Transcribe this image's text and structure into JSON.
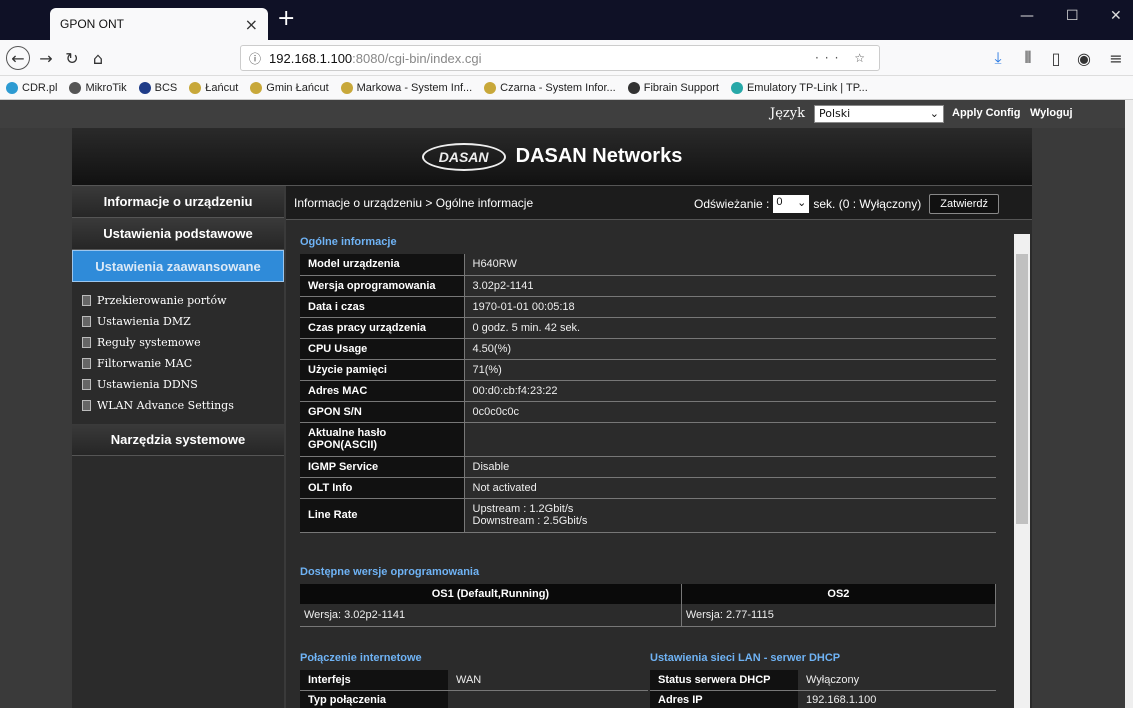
{
  "browser": {
    "tab_title": "GPON ONT",
    "tab_close": "×",
    "new_tab": "+",
    "url_host": "192.168.1.100",
    "url_rest": ":8080/cgi-bin/index.cgi",
    "url_actions": "··· ☆",
    "bookmarks": [
      {
        "label": "CDR.pl",
        "color": "#2d9bd2"
      },
      {
        "label": "MikroTik",
        "color": "#555555"
      },
      {
        "label": "BCS",
        "color": "#1f3c88"
      },
      {
        "label": "Łańcut",
        "color": "#c8a83a"
      },
      {
        "label": "Gmin Łańcut",
        "color": "#c8a83a"
      },
      {
        "label": "Markowa - System Inf...",
        "color": "#c8a83a"
      },
      {
        "label": "Czarna - System Infor...",
        "color": "#c8a83a"
      },
      {
        "label": "Fibrain Support",
        "color": "#333333"
      },
      {
        "label": "Emulatory TP-Link | TP...",
        "color": "#27a8a8"
      }
    ]
  },
  "topbar": {
    "lang_label": "Język",
    "lang_value": "Polski",
    "apply": "Apply Config",
    "logout": "Wyloguj"
  },
  "header": {
    "logo_text": "DASAN",
    "brand": "DASAN Networks"
  },
  "sidebar": {
    "menu1": "Informacje o urządzeniu",
    "menu2": "Ustawienia podstawowe",
    "menu3": "Ustawienia zaawansowane",
    "submenu": [
      "Przekierowanie portów",
      "Ustawienia DMZ",
      "Reguły systemowe",
      "Filtorwanie MAC",
      "Ustawienia DDNS",
      "WLAN Advance Settings"
    ],
    "menu4": "Narzędzia systemowe"
  },
  "main": {
    "breadcrumb": "Informacje o urządzeniu > Ogólne informacje",
    "refresh_label": "Odświeżanie :",
    "refresh_value": "0",
    "refresh_suffix": "sek. (0 : Wyłączony)",
    "confirm": "Zatwierdź",
    "general_title": "Ogólne informacje",
    "general": [
      {
        "k": "Model urządzenia",
        "v": "H640RW"
      },
      {
        "k": "Wersja oprogramowania",
        "v": "3.02p2-1141"
      },
      {
        "k": "Data i czas",
        "v": "1970-01-01 00:05:18"
      },
      {
        "k": "Czas pracy urządzenia",
        "v": "0 godz. 5 min. 42 sek."
      },
      {
        "k": "CPU Usage",
        "v": "4.50(%)"
      },
      {
        "k": "Użycie pamięci",
        "v": "71(%)"
      },
      {
        "k": "Adres MAC",
        "v": "00:d0:cb:f4:23:22"
      },
      {
        "k": "GPON S/N",
        "v": "0c0c0c0c"
      },
      {
        "k": "Aktualne hasło GPON(ASCII)",
        "v": ""
      },
      {
        "k": "IGMP Service",
        "v": "Disable"
      },
      {
        "k": "OLT Info",
        "v": "Not activated"
      },
      {
        "k": "Line Rate",
        "v": "Upstream : 1.2Gbit/s",
        "v2": "Downstream : 2.5Gbit/s"
      }
    ],
    "versions_title": "Dostępne wersje oprogramowania",
    "os1_head": "OS1 (Default,Running)",
    "os2_head": "OS2",
    "os1_ver": "Wersja: 3.02p2-1141",
    "os2_ver": "Wersja: 2.77-1115",
    "wan_title": "Połączenie internetowe",
    "wan_rows": [
      {
        "k": "Interfejs",
        "v": "WAN"
      },
      {
        "k": "Typ połączenia",
        "v": ""
      }
    ],
    "lan_title": "Ustawienia sieci LAN - serwer DHCP",
    "lan_rows": [
      {
        "k": "Status serwera DHCP",
        "v": "Wyłączony"
      },
      {
        "k": "Adres IP",
        "v": "192.168.1.100"
      }
    ]
  }
}
